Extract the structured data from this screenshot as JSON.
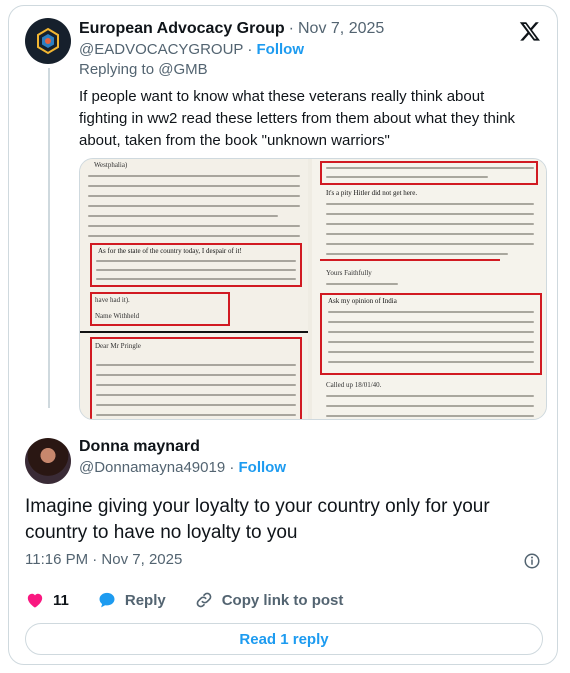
{
  "parent_tweet": {
    "author_name": "European Advocacy Group",
    "date": "Nov 7, 2025",
    "separator": "·",
    "handle": "@EADVOCACYGROUP",
    "follow_label": "Follow",
    "replying_to": "Replying to @GMB",
    "text": "If people want to know what these veterans really think about fighting in ww2 read these letters from them about what they think about, taken from the book \"unknown warriors\"",
    "brand_icon": "x-logo-icon",
    "media": {
      "alt": "Scanned book pages with letters from WW2 veterans, passages outlined in red",
      "left_page_snippets": [
        "Westphalia)",
        "As for the state of the country today, I despair of it!",
        "have had it).",
        "Name Withheld",
        "Dear Mr Pringle"
      ],
      "right_page_snippets": [
        "It's a pity Hitler did not get here.",
        "Yours Faithfully",
        "Ask my opinion of India",
        "Called up 18/01/40."
      ]
    }
  },
  "reply_tweet": {
    "author_name": "Donna maynard",
    "handle": "@Donnamayna49019",
    "separator": "·",
    "follow_label": "Follow",
    "text": "Imagine giving your loyalty to your country only for your country to have no loyalty to you",
    "time": "11:16 PM · Nov 7, 2025",
    "likes": "11",
    "reply_label": "Reply",
    "copy_label": "Copy link to post",
    "read_replies_label": "Read 1 reply"
  },
  "colors": {
    "accent": "#1d9bf0",
    "like": "#f91880",
    "muted": "#536471",
    "border": "#cfd9de",
    "highlight_box": "#d11a22"
  }
}
